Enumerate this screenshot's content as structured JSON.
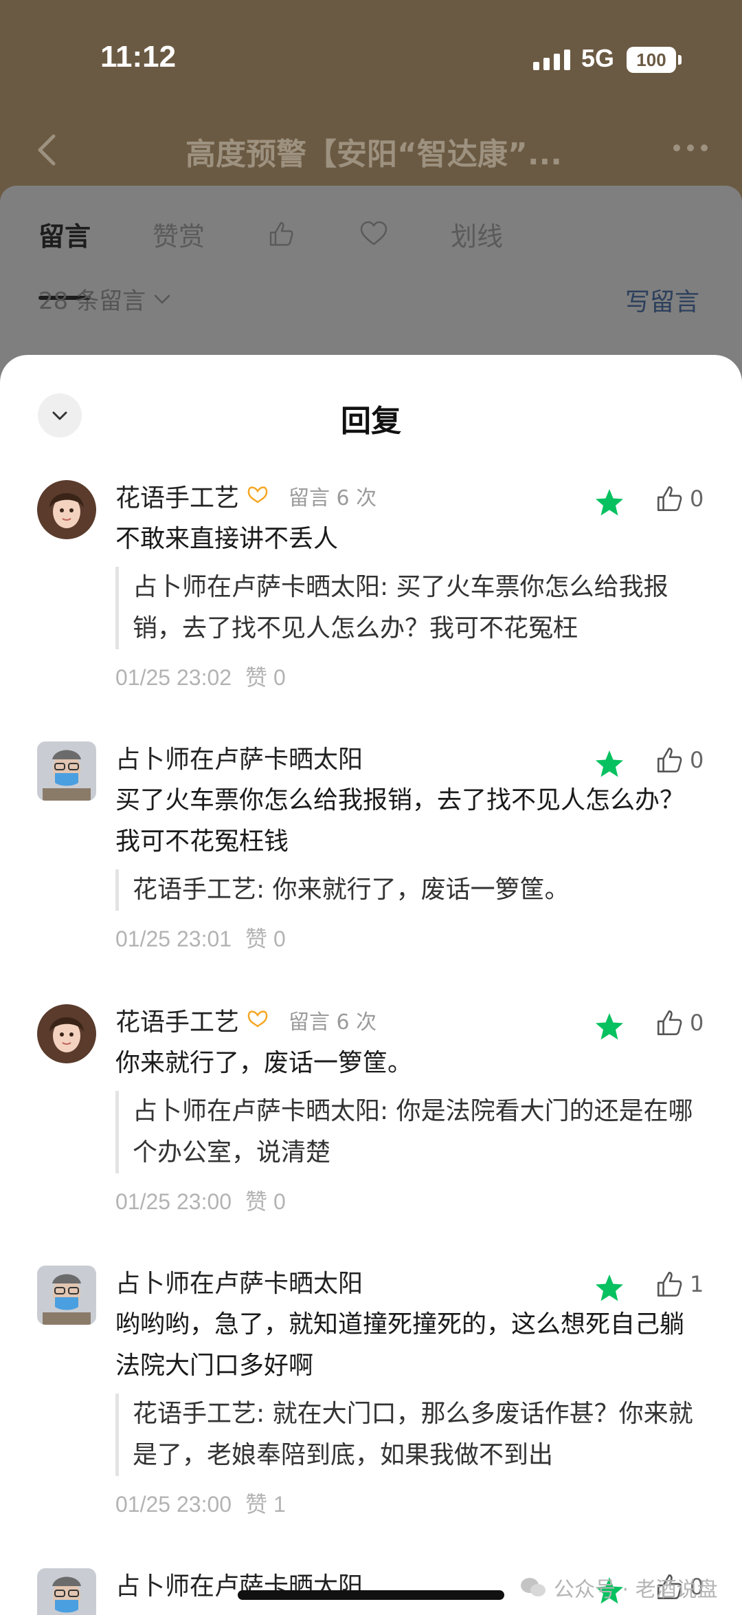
{
  "status_bar": {
    "time": "11:12",
    "network": "5G",
    "battery": "100"
  },
  "nav": {
    "title": "高度预警【安阳“智达康”..."
  },
  "tabs": [
    {
      "label": "留言",
      "active": true
    },
    {
      "label": "赞赏"
    },
    {
      "icon": "thumbs-up-icon"
    },
    {
      "icon": "heart-icon"
    },
    {
      "label": "划线"
    }
  ],
  "comments_summary": {
    "count_label": "28 条留言",
    "write_label": "写留言"
  },
  "sheet": {
    "title": "回复"
  },
  "comments": [
    {
      "name": "花语手工艺",
      "count_label": "留言 6 次",
      "text": "不敢来直接讲不丢人",
      "quote": "占卜师在卢萨卡晒太阳: 买了火车票你怎么给我报销，去了找不见人怎么办？我可不花冤枉",
      "time": "01/25 23:02",
      "likes_label": "赞 0",
      "like_count": "0"
    },
    {
      "name": "占卜师在卢萨卡晒太阳",
      "text": "买了火车票你怎么给我报销，去了找不见人怎么办？我可不花冤枉钱",
      "quote": "花语手工艺: 你来就行了，废话一箩筐。",
      "time": "01/25 23:01",
      "likes_label": "赞 0",
      "like_count": "0"
    },
    {
      "name": "花语手工艺",
      "count_label": "留言 6 次",
      "text": "你来就行了，废话一箩筐。",
      "quote": "占卜师在卢萨卡晒太阳: 你是法院看大门的还是在哪个办公室，说清楚",
      "time": "01/25 23:00",
      "likes_label": "赞 0",
      "like_count": "0"
    },
    {
      "name": "占卜师在卢萨卡晒太阳",
      "text": "哟哟哟，急了，就知道撞死撞死的，这么想死自己躺法院大门口多好啊",
      "quote": "花语手工艺: 就在大门口，那么多废话作甚？你来就是了，老娘奉陪到底，如果我做不到出",
      "time": "01/25 23:00",
      "likes_label": "赞 1",
      "like_count": "1"
    },
    {
      "name": "占卜师在卢萨卡晒太阳",
      "like_count": "0"
    }
  ],
  "watermark": "公众号 · 老酒说盘",
  "colors": {
    "star": "#07c160",
    "dim_header": "#6b5a43",
    "badge": "#f5a623"
  }
}
